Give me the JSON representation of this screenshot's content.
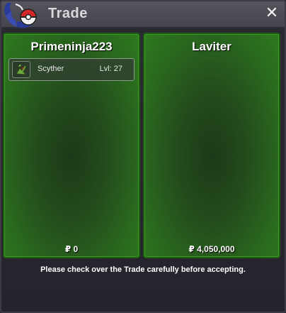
{
  "window": {
    "title": "Trade",
    "close_icon": "close-icon",
    "logo_icon": "pokeball-logo-icon"
  },
  "left_panel": {
    "player_name": "Primeninja223",
    "pokemon": [
      {
        "name": "Scyther",
        "level": "Lvl: 27",
        "icon": "scyther-icon"
      }
    ],
    "money": "₽ 0"
  },
  "right_panel": {
    "player_name": "Laviter",
    "pokemon": [],
    "money": "₽ 4,050,000"
  },
  "notice": "Please check over the Trade carefully before accepting.",
  "colors": {
    "panel_green": "#2f7a1f",
    "titlebar": "#4d4c54",
    "background": "#2a2830"
  }
}
